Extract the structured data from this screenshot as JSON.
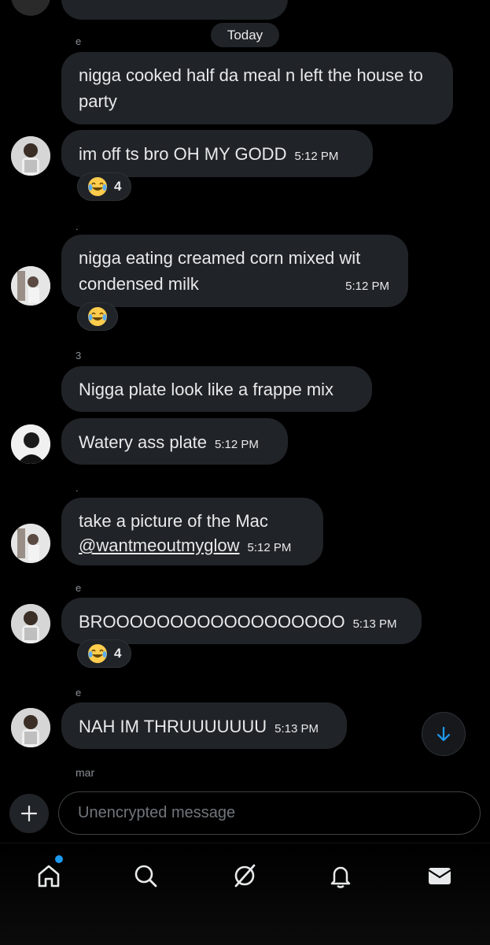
{
  "date_divider": "Today",
  "messages": [
    {
      "sender": "e",
      "text": "nigga cooked half da meal n left the house to party",
      "time": ""
    },
    {
      "sender": "",
      "text": "im off ts bro OH MY GODD",
      "time": "5:12 PM",
      "reaction": {
        "emoji": "joy",
        "count": "4"
      }
    },
    {
      "sender": ".",
      "text": "nigga eating creamed corn mixed wit condensed milk",
      "time": "5:12 PM",
      "reaction": {
        "emoji": "joy",
        "count": ""
      }
    },
    {
      "sender": "3",
      "text": "Nigga plate look like a frappe mix",
      "time": ""
    },
    {
      "sender": "",
      "text": "Watery ass plate",
      "time": "5:12 PM"
    },
    {
      "sender": ".",
      "text": "take a picture of the Mac",
      "mention": "@wantmeoutmyglow",
      "time": "5:12 PM"
    },
    {
      "sender": "e",
      "text": "BROOOOOOOOOOOOOOOOOO",
      "time": "5:13 PM",
      "reaction": {
        "emoji": "joy",
        "count": "4"
      }
    },
    {
      "sender": "e",
      "text": "NAH IM THRUUUUUUU",
      "time": "5:13 PM"
    },
    {
      "sender": "mar",
      "text": "",
      "time": ""
    }
  ],
  "composer": {
    "placeholder": "Unencrypted message"
  },
  "nav": {
    "items": [
      "home-icon",
      "search-icon",
      "grok-icon",
      "notifications-icon",
      "messages-icon"
    ],
    "home_badge": true
  },
  "colors": {
    "bubble": "#202327",
    "accent": "#1d9bf0",
    "background": "#000000"
  }
}
